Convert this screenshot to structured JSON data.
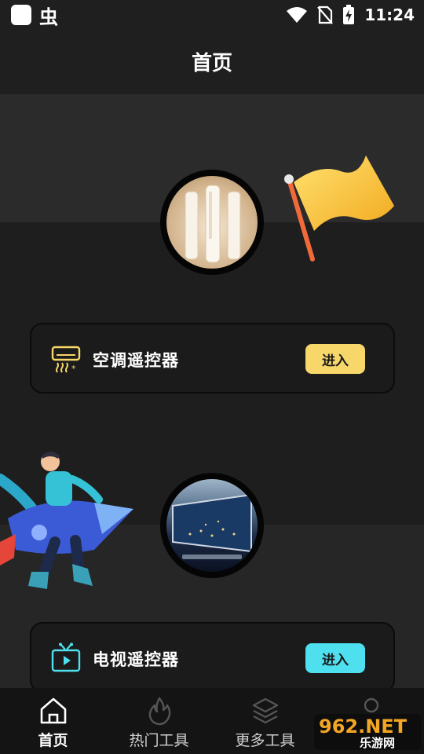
{
  "status_bar": {
    "app_glyph": "虫",
    "time": "11:24",
    "icons": [
      "wifi-icon",
      "no-sim-icon",
      "battery-charging-icon"
    ]
  },
  "header": {
    "title": "首页"
  },
  "cards": [
    {
      "id": "ac",
      "label": "空调遥控器",
      "button": "进入",
      "icon": "air-conditioner-icon",
      "accent": "#f7d769"
    },
    {
      "id": "tv",
      "label": "电视遥控器",
      "button": "进入",
      "icon": "tv-icon",
      "accent": "#4fe0ef"
    }
  ],
  "tabs": [
    {
      "label": "首页",
      "icon": "home-icon",
      "active": true
    },
    {
      "label": "热门工具",
      "icon": "flame-icon",
      "active": false
    },
    {
      "label": "更多工具",
      "icon": "layers-icon",
      "active": false
    },
    {
      "label": "",
      "icon": "user-icon",
      "active": false
    }
  ],
  "watermark": {
    "brand": "962.NET",
    "sub": "乐游网"
  }
}
